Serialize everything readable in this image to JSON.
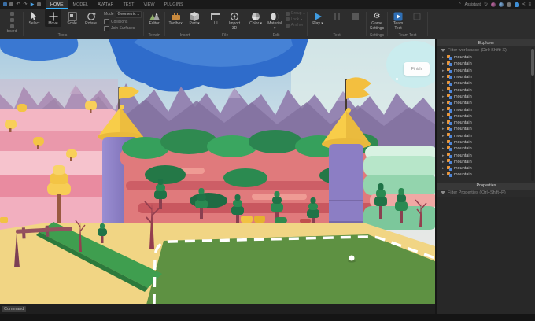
{
  "titlebar": {
    "tabs": [
      {
        "label": "HOME",
        "active": true
      },
      {
        "label": "MODEL",
        "active": false
      },
      {
        "label": "AVATAR",
        "active": false
      },
      {
        "label": "TEST",
        "active": false
      },
      {
        "label": "VIEW",
        "active": false
      },
      {
        "label": "PLUGINS",
        "active": false
      }
    ],
    "assistant_label": "Assistant"
  },
  "ribbon": {
    "clipboard": {
      "label": "board"
    },
    "tools": {
      "label": "Tools",
      "items": [
        "Select",
        "Move",
        "Scale",
        "Rotate"
      ],
      "active_item": "Move"
    },
    "mode": {
      "label": "Mode",
      "value": "Geometric",
      "collisions": "Collisions",
      "join_surfaces": "Join Surfaces"
    },
    "terrain": {
      "label": "Terrain",
      "editor": "Editor"
    },
    "insert": {
      "label": "Insert",
      "toolbox": "Toolbox",
      "part": "Part"
    },
    "file": {
      "label": "File",
      "ui": "UI",
      "import3d": "Import 3D"
    },
    "edit": {
      "label": "Edit",
      "color": "Color",
      "material": "Material",
      "stack": [
        "Group",
        "Lock",
        "Anchor"
      ]
    },
    "test": {
      "label": "Test",
      "play": "Play"
    },
    "settings": {
      "label": "Settings",
      "game_settings": "Game Settings"
    },
    "team_test": {
      "label": "Team Test",
      "team_test": "Team Test"
    }
  },
  "viewport": {
    "badge": "Finish"
  },
  "explorer": {
    "title": "Explorer",
    "filter_placeholder": "Filter workspace (Ctrl+Shift+X)",
    "items": [
      "mountain",
      "mountain",
      "mountain",
      "mountain",
      "mountain",
      "mountain",
      "mountain",
      "mountain",
      "mountain",
      "mountain",
      "mountain",
      "mountain",
      "mountain",
      "mountain",
      "mountain",
      "mountain",
      "mountain",
      "mountain",
      "mountain"
    ]
  },
  "properties": {
    "title": "Properties",
    "filter_placeholder": "Filter Properties (Ctrl+Shift+P)"
  },
  "command_bar": {
    "text": "Command"
  },
  "colors": {
    "accent": "#35b3ff",
    "sky": "#cfe0ea",
    "cloud_blue": "#2f6ccb",
    "mountain_purple": "#9585b2",
    "cliff_red": "#e07a7c",
    "ledge_green": "#36a05c",
    "lawn_green": "#5e9142",
    "path_tan": "#f1d584",
    "tower_purple": "#8c7ec4",
    "roof_yellow": "#f8cd49",
    "pink_terrace": "#f3b6c3"
  }
}
